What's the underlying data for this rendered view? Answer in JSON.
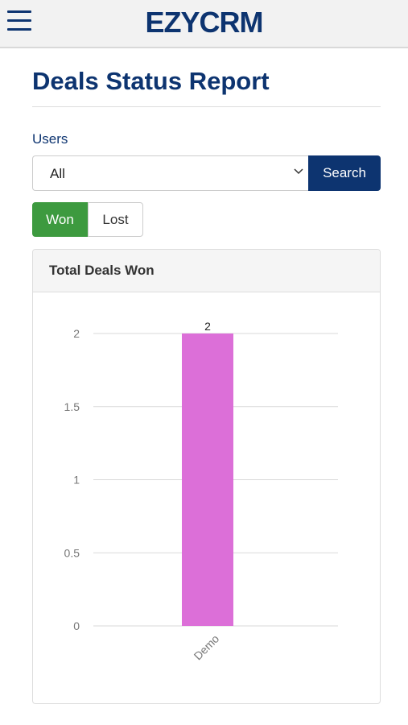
{
  "header": {
    "logo_text": "EZYCRM",
    "menu_icon": "hamburger-icon"
  },
  "page": {
    "title": "Deals Status Report"
  },
  "filters": {
    "users_label": "Users",
    "users_selected": "All",
    "search_label": "Search"
  },
  "toggle": {
    "won_label": "Won",
    "lost_label": "Lost",
    "active": "Won"
  },
  "colors": {
    "brand": "#0d3470",
    "won": "#3d9a3f",
    "bar": "#dc6fd8"
  },
  "panel": {
    "title": "Total Deals Won"
  },
  "chart_data": {
    "type": "bar",
    "title": "",
    "categories": [
      "Demo"
    ],
    "values": [
      2
    ],
    "data_labels": [
      "2"
    ],
    "y_ticks": [
      "0",
      "0.5",
      "1",
      "1.5",
      "2"
    ],
    "ylim": [
      0,
      2
    ],
    "grid": true,
    "xlabel": "",
    "ylabel": ""
  }
}
